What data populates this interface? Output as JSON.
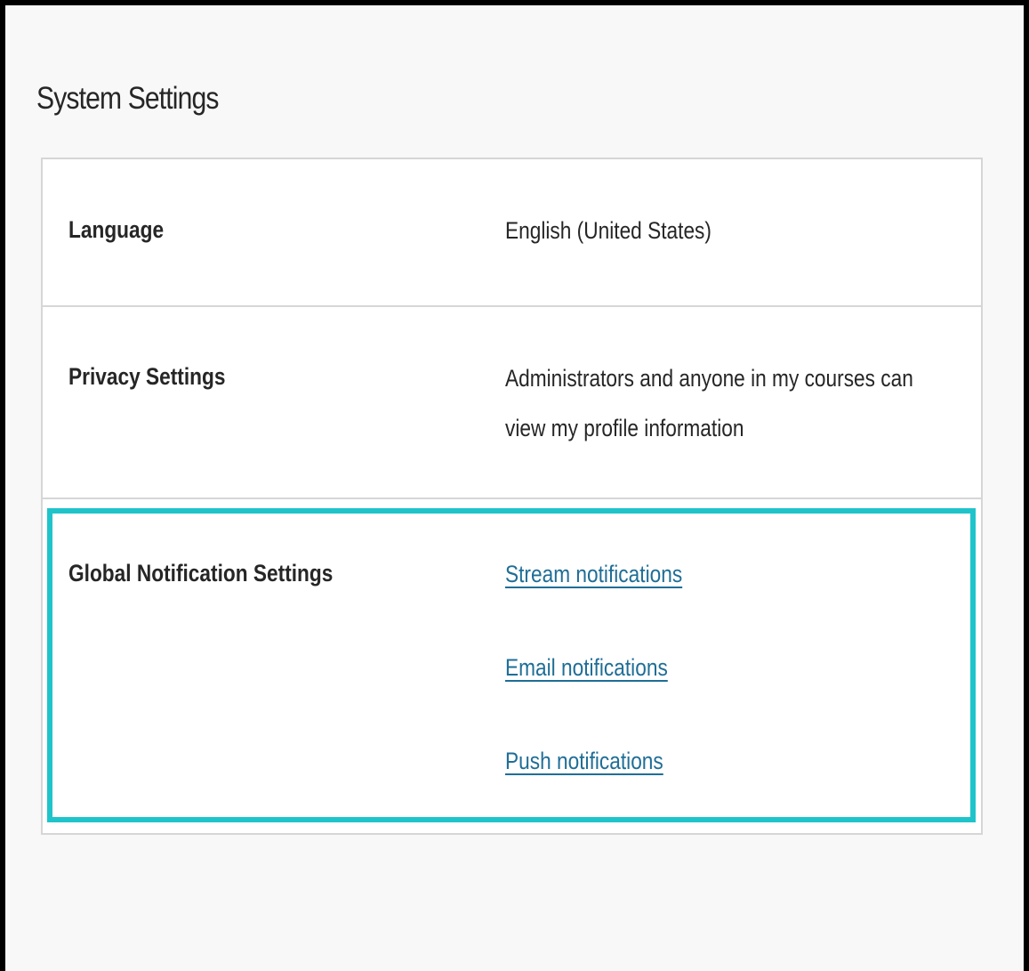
{
  "page": {
    "title": "System Settings"
  },
  "settings": {
    "language": {
      "label": "Language",
      "value": "English (United States)"
    },
    "privacy": {
      "label": "Privacy Settings",
      "value": "Administrators and anyone in my courses can view my profile information"
    },
    "notifications": {
      "label": "Global Notification Settings",
      "links": [
        {
          "label": "Stream notifications"
        },
        {
          "label": "Email notifications"
        },
        {
          "label": "Push notifications"
        }
      ]
    }
  },
  "colors": {
    "highlight": "#1fc4cb",
    "link": "#1f6e96",
    "text": "#262626",
    "border": "#d6d6d6",
    "frame": "#000000"
  }
}
